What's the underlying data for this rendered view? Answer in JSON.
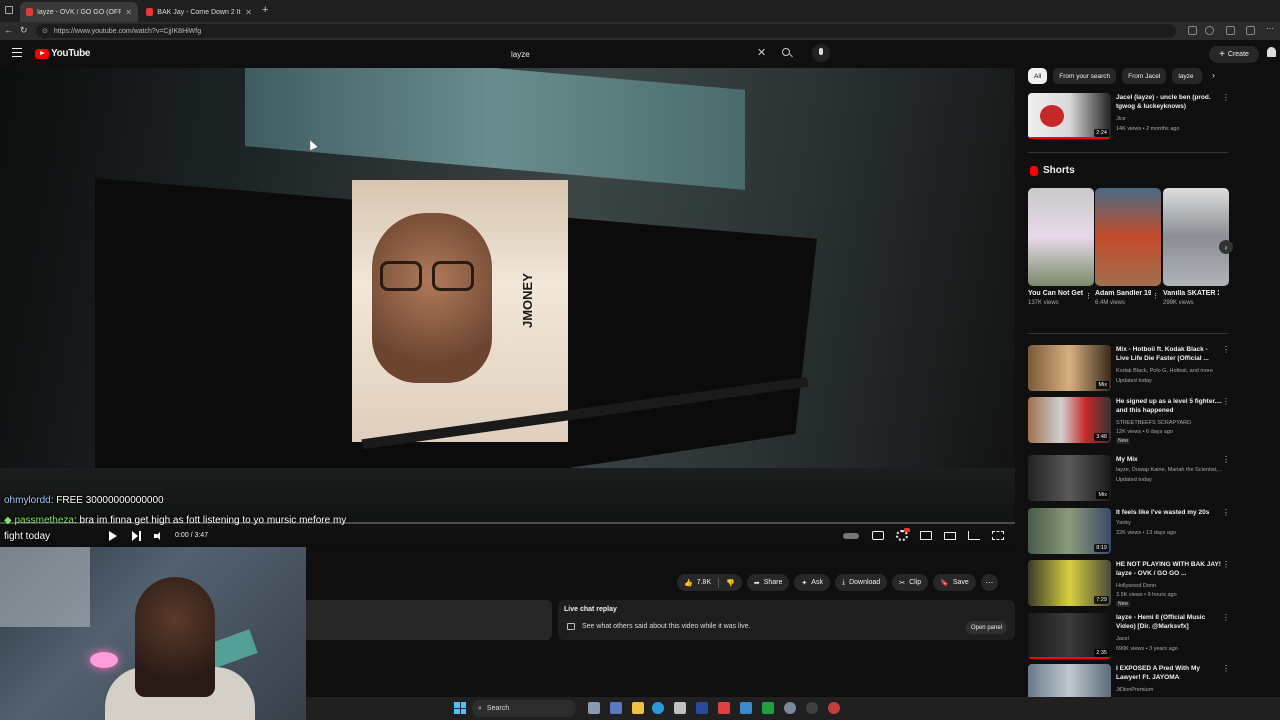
{
  "browser": {
    "tabs": [
      {
        "label": "layze - OVK / GO GO (OFFICIAL M"
      },
      {
        "label": "BAK Jay - Come Down 2 It / Rat M"
      }
    ],
    "url": "https://www.youtube.com/watch?v=CjjIK8HiWfg"
  },
  "header": {
    "logo_text": "YouTube",
    "search_value": "layze",
    "create_label": "Create"
  },
  "player": {
    "time": "0:00 / 3:47",
    "progress_fraction": 0.0,
    "watermark_text": "JMONEY",
    "chat": [
      {
        "user": "ohmylordd",
        "message": ": FREE 30000000000000"
      },
      {
        "user": "passmetheza",
        "message": ": bra im finna get high as fott listening to yo mursic mefore my"
      },
      {
        "continuation": "fight today"
      }
    ]
  },
  "actions": {
    "likes": "7.8K",
    "share": "Share",
    "ask": "Ask",
    "download": "Download",
    "clip": "Clip",
    "save": "Save"
  },
  "live_chat_replay": {
    "title": "Live chat replay",
    "subtitle": "See what others said about this video while it was live.",
    "open_label": "Open panel"
  },
  "sidebar": {
    "chips": [
      "All",
      "From your search",
      "From Jacel",
      "layze"
    ],
    "top_video": {
      "title": "Jacel (layze) - uncle ben (prod. tgwog & luckeyknows)",
      "channel": "Jlce",
      "meta": "14K views • 2 months ago",
      "duration": "2:24"
    },
    "shorts_label": "Shorts",
    "shorts": [
      {
        "title": "You Can Not Get These ...",
        "views": "137K views"
      },
      {
        "title": "Adam Sandler 19...",
        "views": "6.4M views"
      },
      {
        "title": "Vanilla SKATER XL...",
        "views": "299K views"
      }
    ],
    "videos": [
      {
        "title": "Mix - Hotboii ft. Kodak Black - Live Life Die Faster (Official ...",
        "channel": "Kodak Black, Polo G, Hotboii, and more",
        "meta": "Updated today",
        "badge": "Mix"
      },
      {
        "title": "He signed up as a level 5 fighter.... and this happened",
        "channel": "STREETBEEFS SCRAPYARD",
        "meta": "12K views • 6 days ago",
        "new": "New",
        "duration": "3:48"
      },
      {
        "title": "My Mix",
        "channel": "layze, Duwap Kaine, Mariah the Scientist,...",
        "meta": "Updated today",
        "badge": "Mix"
      },
      {
        "title": "It feels like I've wasted my 20s",
        "channel": "Yanky",
        "meta": "22K views • 13 days ago",
        "duration": "8:19"
      },
      {
        "title": "HE NOT PLAYING WITH BAK JAY! layze - OVK / GO GO ...",
        "channel": "Hollywood Donn",
        "meta": "3.5K views • 9 hours ago",
        "new": "New",
        "duration": "7:29"
      },
      {
        "title": "layze - Hemi II (Official Music Video) [Dir. @Marksvfx]",
        "channel": "Jacel",
        "meta": "690K views • 3 years ago",
        "duration": "2:35"
      },
      {
        "title": "I EXPOSED A Pred With My Lawyer! Ft. JAYOMA",
        "channel": "JiDionPremium",
        "meta": ""
      }
    ]
  },
  "taskbar": {
    "search_label": "Search"
  },
  "colors": {
    "accent": "#ff0000",
    "background": "#0f0f0f"
  }
}
